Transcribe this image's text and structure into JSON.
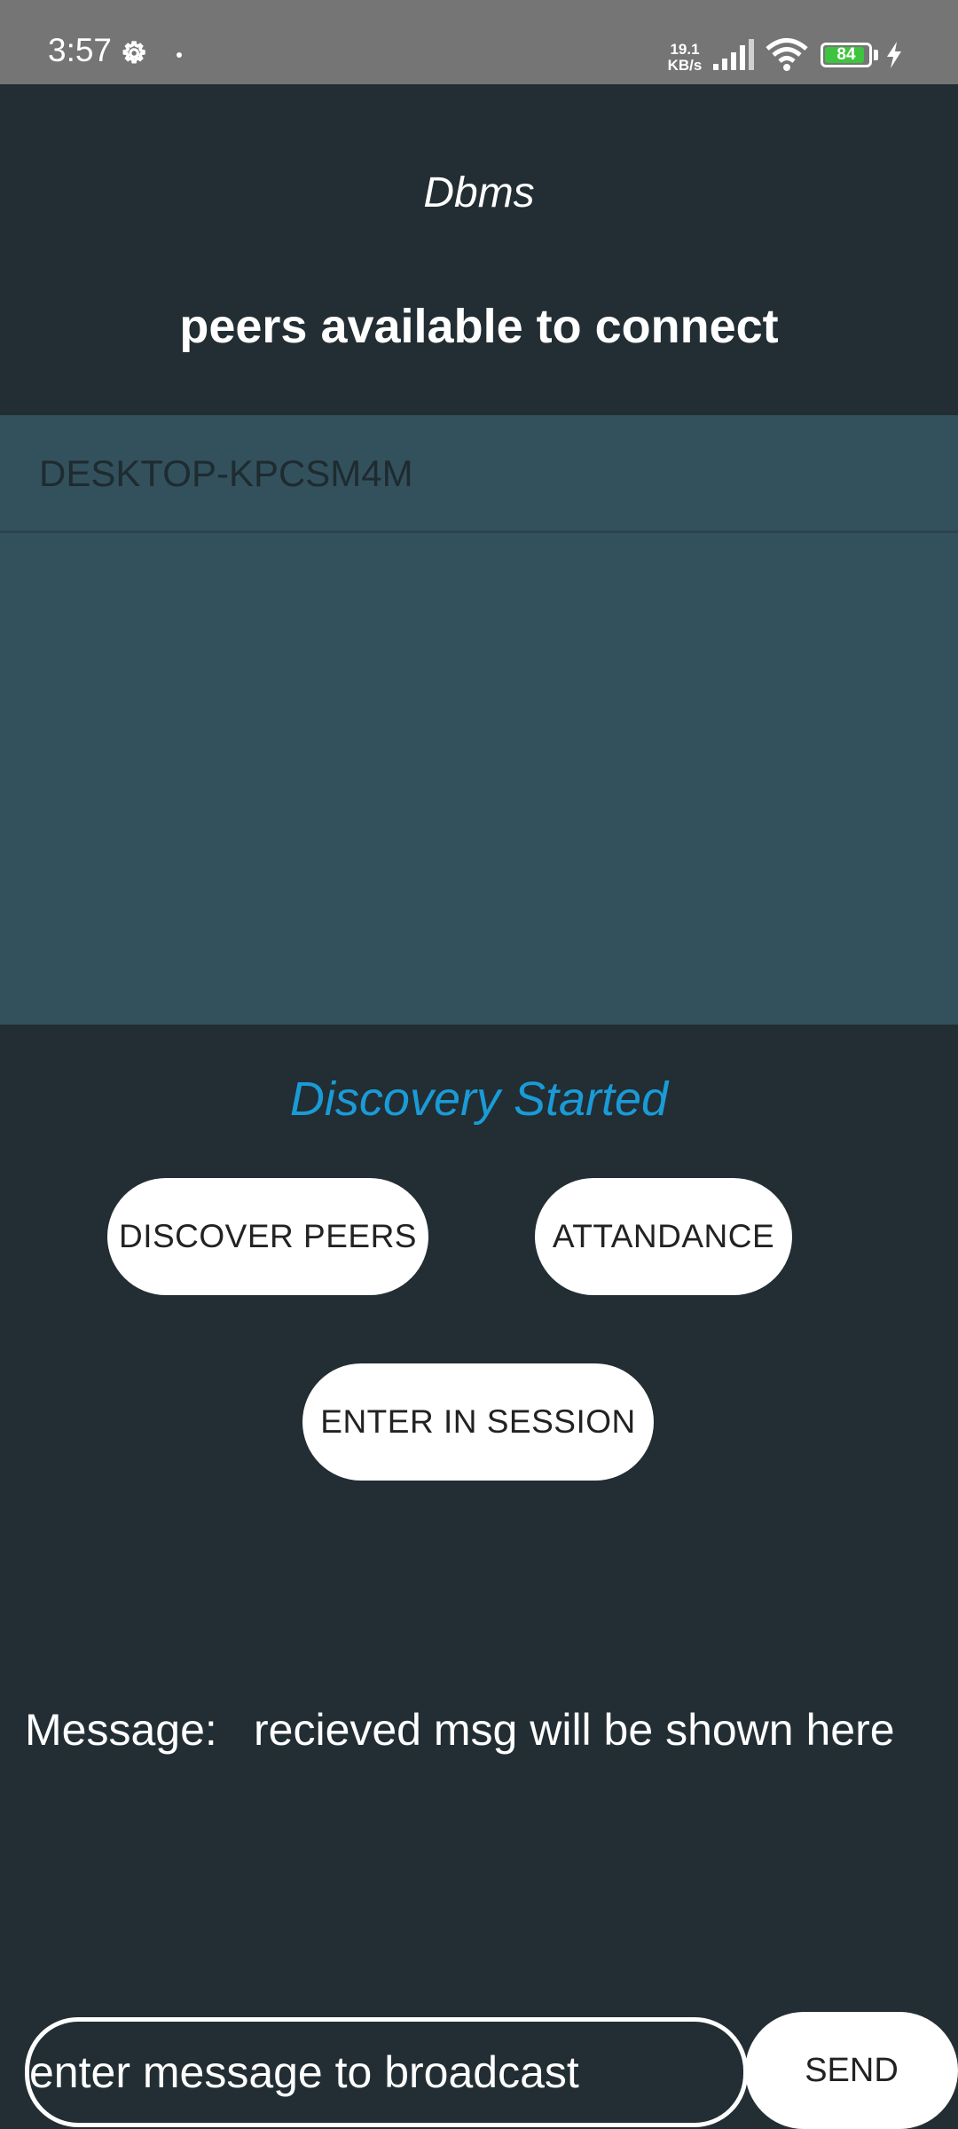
{
  "status_bar": {
    "time": "3:57",
    "net_speed_value": "19.1",
    "net_speed_unit": "KB/s",
    "battery_level": "84",
    "icons": [
      "gear-icon",
      "notification-dot-icon",
      "cell-signal-icon",
      "wifi-icon",
      "battery-icon",
      "charging-bolt-icon"
    ],
    "battery_color": "#3ec43e"
  },
  "app": {
    "title": "Dbms",
    "peers_heading": "peers available to connect",
    "peers": [
      {
        "name": "DESKTOP-KPCSM4M"
      }
    ],
    "discovery_status": "Discovery Started",
    "buttons": {
      "discover_peers": "DISCOVER PEERS",
      "attendance": "ATTANDANCE",
      "enter_session": "ENTER IN SESSION",
      "send": "SEND"
    },
    "message": {
      "label": "Message:",
      "value": "recieved msg will be shown here"
    },
    "broadcast_input": {
      "placeholder": "enter message to broadcast",
      "value": ""
    },
    "colors": {
      "background": "#222e33",
      "list_background": "#33515c",
      "accent": "#1a9bd7",
      "status_bar": "#757575"
    }
  }
}
